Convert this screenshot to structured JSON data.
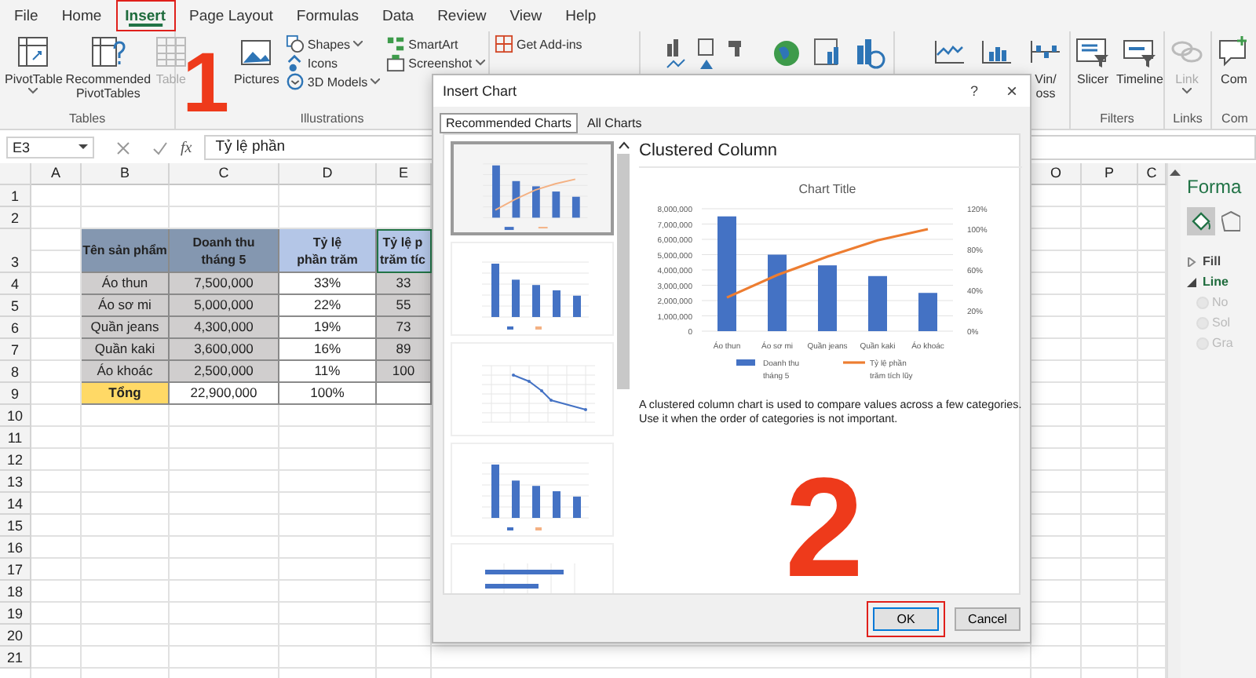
{
  "menu_tabs": [
    {
      "label": "File",
      "selected": false,
      "highlighted": false
    },
    {
      "label": "Home",
      "selected": false,
      "highlighted": false
    },
    {
      "label": "Insert",
      "selected": true,
      "highlighted": true
    },
    {
      "label": "Page Layout",
      "selected": false,
      "highlighted": false
    },
    {
      "label": "Formulas",
      "selected": false,
      "highlighted": false
    },
    {
      "label": "Data",
      "selected": false,
      "highlighted": false
    },
    {
      "label": "Review",
      "selected": false,
      "highlighted": false
    },
    {
      "label": "View",
      "selected": false,
      "highlighted": false
    },
    {
      "label": "Help",
      "selected": false,
      "highlighted": false
    }
  ],
  "ribbon": {
    "groups": [
      {
        "kind": "commands",
        "label": "Tables",
        "commands": [
          {
            "kind": "large",
            "label": "PivotTable",
            "dropdown": true,
            "disabled": false
          },
          {
            "kind": "large",
            "label": "Recommended PivotTables",
            "dropdown": false,
            "disabled": false
          },
          {
            "kind": "large",
            "label": "Table",
            "dropdown": false,
            "disabled": true
          }
        ]
      },
      {
        "kind": "commands",
        "label": "Illustrations",
        "commands": [
          {
            "kind": "large",
            "label": "Pictures",
            "dropdown": false,
            "disabled": false
          },
          {
            "kind": "small",
            "label": "Shapes",
            "dropdown": true,
            "disabled": false
          },
          {
            "kind": "small",
            "label": "Icons",
            "dropdown": false,
            "disabled": false
          },
          {
            "kind": "small",
            "label": "3D Models",
            "dropdown": true,
            "disabled": false
          },
          {
            "kind": "small",
            "label": "SmartArt",
            "dropdown": false,
            "disabled": false
          },
          {
            "kind": "small",
            "label": "Screenshot",
            "dropdown": true,
            "disabled": false
          }
        ]
      },
      {
        "kind": "commands",
        "commands": [
          {
            "kind": "small",
            "label": "Get Add-ins",
            "dropdown": false,
            "disabled": false
          }
        ]
      },
      {
        "kind": "icons"
      },
      {
        "kind": "commands",
        "commands": [
          {
            "kind": "large",
            "dropdown": false,
            "disabled": false
          },
          {
            "kind": "large",
            "dropdown": false,
            "disabled": false
          },
          {
            "kind": "large",
            "label": "Vin/ oss",
            "dropdown": false,
            "disabled": false
          }
        ]
      },
      {
        "kind": "commands",
        "label": "Filters",
        "commands": [
          {
            "kind": "large",
            "label": "Slicer",
            "dropdown": false,
            "disabled": false
          },
          {
            "kind": "large",
            "label": "Timeline",
            "dropdown": false,
            "disabled": false
          }
        ]
      },
      {
        "kind": "commands",
        "label": "Links",
        "commands": [
          {
            "kind": "large",
            "label": "Link",
            "dropdown": true,
            "disabled": true
          }
        ]
      },
      {
        "kind": "commands",
        "label": "Com",
        "commands": [
          {
            "kind": "large",
            "label": "Com",
            "dropdown": false,
            "disabled": false
          }
        ]
      }
    ]
  },
  "formula_bar": {
    "name_box": "E3",
    "fx": "fx",
    "formula": "Tỷ lệ phần"
  },
  "sheet": {
    "columns_left": [
      "A",
      "B",
      "C",
      "D",
      "E"
    ],
    "columns_right": [
      "O",
      "P",
      "C"
    ],
    "row_numbers": [
      "1",
      "2",
      "3",
      "4",
      "5",
      "6",
      "7",
      "8",
      "9",
      "10",
      "11",
      "12",
      "13",
      "14",
      "15",
      "16",
      "17",
      "18",
      "19",
      "20",
      "21"
    ],
    "table_rows": [
      [
        {
          "text": "Tên sản phẩm",
          "kind": "header_dark",
          "selected": false
        },
        {
          "text": "Doanh thu\ntháng 5",
          "kind": "header_dark",
          "selected": false
        },
        {
          "text": "Tỷ lệ\nphần trăm",
          "kind": "header_light",
          "selected": false
        },
        {
          "text": "Tỷ lệ p\ntrăm tíc",
          "kind": "header_light",
          "selected": true
        }
      ],
      [
        {
          "text": "Áo thun",
          "kind": "grey",
          "selected": false
        },
        {
          "text": "7,500,000",
          "kind": "grey",
          "selected": false
        },
        {
          "text": "33%",
          "kind": "white",
          "selected": false
        },
        {
          "text": "33",
          "kind": "grey",
          "selected": false
        }
      ],
      [
        {
          "text": "Áo sơ mi",
          "kind": "grey",
          "selected": false
        },
        {
          "text": "5,000,000",
          "kind": "grey",
          "selected": false
        },
        {
          "text": "22%",
          "kind": "white",
          "selected": false
        },
        {
          "text": "55",
          "kind": "grey",
          "selected": false
        }
      ],
      [
        {
          "text": "Quần jeans",
          "kind": "grey",
          "selected": false
        },
        {
          "text": "4,300,000",
          "kind": "grey",
          "selected": false
        },
        {
          "text": "19%",
          "kind": "white",
          "selected": false
        },
        {
          "text": "73",
          "kind": "grey",
          "selected": false
        }
      ],
      [
        {
          "text": "Quần kaki",
          "kind": "grey",
          "selected": false
        },
        {
          "text": "3,600,000",
          "kind": "grey",
          "selected": false
        },
        {
          "text": "16%",
          "kind": "white",
          "selected": false
        },
        {
          "text": "89",
          "kind": "grey",
          "selected": false
        }
      ],
      [
        {
          "text": "Áo khoác",
          "kind": "grey",
          "selected": false
        },
        {
          "text": "2,500,000",
          "kind": "grey",
          "selected": false
        },
        {
          "text": "11%",
          "kind": "white",
          "selected": false
        },
        {
          "text": "100",
          "kind": "grey",
          "selected": false
        }
      ],
      [
        {
          "text": "Tổng",
          "kind": "total",
          "selected": false
        },
        {
          "text": "22,900,000",
          "kind": "white",
          "selected": false
        },
        {
          "text": "100%",
          "kind": "white",
          "selected": false
        },
        {
          "kind": "white",
          "selected": false
        }
      ]
    ]
  },
  "dialog": {
    "title": "Insert Chart",
    "help": "?",
    "close": "×",
    "tabs": [
      {
        "label": "Recommended Charts",
        "selected": true
      },
      {
        "label": "All Charts",
        "selected": false
      }
    ],
    "thumbnails": [
      {
        "kind": "combo",
        "selected": true
      },
      {
        "kind": "column",
        "selected": false
      },
      {
        "kind": "line",
        "selected": false
      },
      {
        "kind": "column",
        "selected": false
      },
      {
        "kind": "bar",
        "selected": false
      }
    ],
    "preview": {
      "title": "Clustered Column",
      "chart_data": {
        "type": "bar",
        "title": "Chart Title",
        "categories": [
          "Áo thun",
          "Áo sơ mi",
          "Quần jeans",
          "Quần kaki",
          "Áo khoác"
        ],
        "series": [
          {
            "name": "Doanh thu tháng 5",
            "color": "#4472c4",
            "type": "bar",
            "values": [
              7500000,
              5000000,
              4300000,
              3600000,
              2500000
            ]
          },
          {
            "name": "Tỷ lệ phần trăm tích lũy",
            "color": "#ed7d31",
            "type": "line",
            "axis": "y2",
            "values": [
              0.33,
              0.55,
              0.73,
              0.89,
              1.0
            ]
          }
        ],
        "ylim": [
          0,
          8000000
        ],
        "yticks": [
          {
            "value": 0,
            "label": "0"
          },
          {
            "value": 1000000,
            "label": "1,000,000"
          },
          {
            "value": 2000000,
            "label": "2,000,000"
          },
          {
            "value": 3000000,
            "label": "3,000,000"
          },
          {
            "value": 4000000,
            "label": "4,000,000"
          },
          {
            "value": 5000000,
            "label": "5,000,000"
          },
          {
            "value": 6000000,
            "label": "6,000,000"
          },
          {
            "value": 7000000,
            "label": "7,000,000"
          },
          {
            "value": 8000000,
            "label": "8,000,000"
          }
        ],
        "grid": true,
        "legend": true,
        "y2lim": [
          0,
          1.2
        ],
        "y2ticks": [
          {
            "value": 0,
            "label": "0%"
          },
          {
            "value": 0.2,
            "label": "20%"
          },
          {
            "value": 0.4,
            "label": "40%"
          },
          {
            "value": 0.6,
            "label": "60%"
          },
          {
            "value": 0.8,
            "label": "80%"
          },
          {
            "value": 1.0,
            "label": "100%"
          },
          {
            "value": 1.2,
            "label": "120%"
          }
        ]
      },
      "description": "A clustered column chart is used to compare values across a few categories. Use it when the order of categories is not important."
    },
    "buttons": [
      {
        "label": "OK",
        "highlighted": true
      },
      {
        "label": "Cancel",
        "highlighted": false
      }
    ]
  },
  "format_pane": {
    "title": "Forma",
    "sections": [
      {
        "label": "Fill",
        "expanded": false
      },
      {
        "label": "Line",
        "expanded": true
      }
    ],
    "options": [
      {
        "label": "No",
        "disabled": true
      },
      {
        "label": "Sol",
        "disabled": true
      },
      {
        "label": "Gra",
        "disabled": true
      }
    ]
  },
  "annotations": [
    {
      "label": "1"
    },
    {
      "label": "2"
    }
  ]
}
